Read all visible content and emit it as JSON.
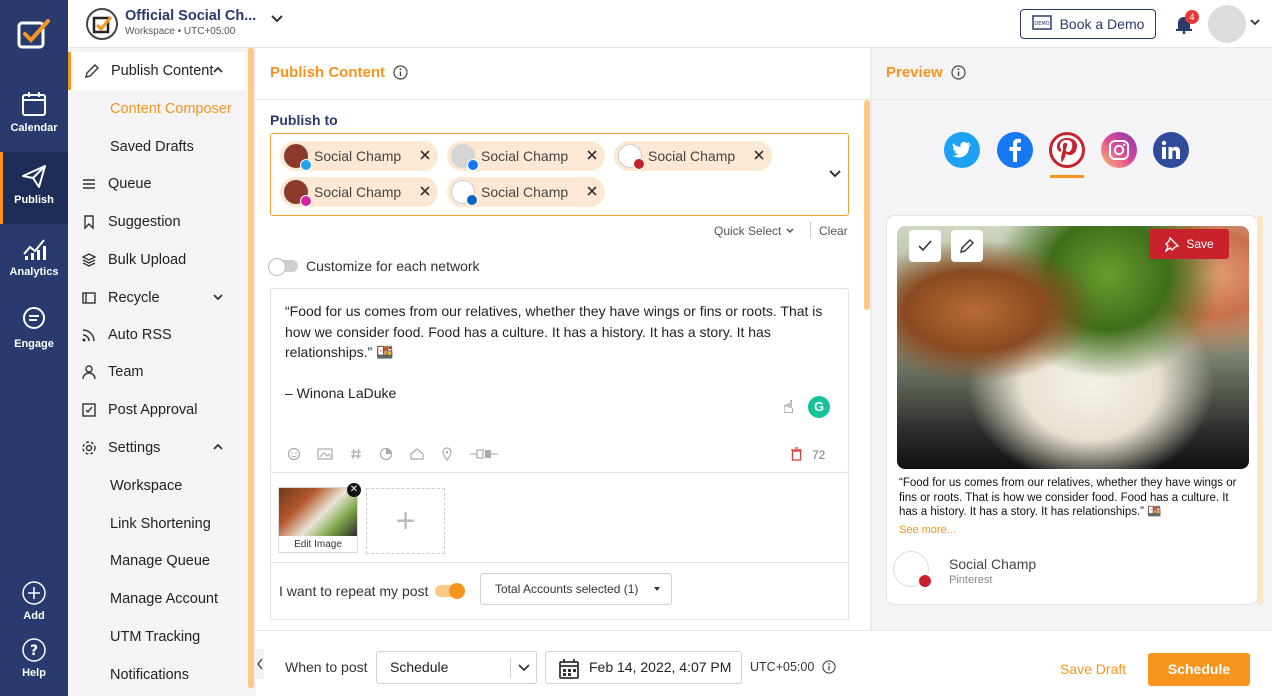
{
  "workspace": {
    "name": "Official Social Ch...",
    "subtitle": "Workspace • UTC+05:00"
  },
  "header": {
    "demo_label": "Book a Demo",
    "notification_count": "4"
  },
  "rail": [
    {
      "label": "Calendar"
    },
    {
      "label": "Publish"
    },
    {
      "label": "Analytics"
    },
    {
      "label": "Engage"
    },
    {
      "label": "Add"
    },
    {
      "label": "Help"
    }
  ],
  "submenu": {
    "publish_content": "Publish Content",
    "content_composer": "Content Composer",
    "saved_drafts": "Saved Drafts",
    "queue": "Queue",
    "suggestion": "Suggestion",
    "bulk_upload": "Bulk Upload",
    "recycle": "Recycle",
    "auto_rss": "Auto RSS",
    "team": "Team",
    "post_approval": "Post Approval",
    "settings": "Settings",
    "workspace": "Workspace",
    "link_shortening": "Link Shortening",
    "manage_queue": "Manage Queue",
    "manage_account": "Manage Account",
    "utm_tracking": "UTM Tracking",
    "notifications": "Notifications"
  },
  "composer": {
    "title": "Publish Content",
    "publish_to": "Publish to",
    "accounts": [
      {
        "name": "Social Champ",
        "network": "twitter",
        "color": "#1da1f2"
      },
      {
        "name": "Social Champ",
        "network": "facebook",
        "color": "#1877f2"
      },
      {
        "name": "Social Champ",
        "network": "pinterest",
        "color": "#c8232c"
      },
      {
        "name": "Social Champ",
        "network": "instagram",
        "color": "#d6249f"
      },
      {
        "name": "Social Champ",
        "network": "linkedin",
        "color": "#0a66c2"
      }
    ],
    "quick_select": "Quick Select",
    "clear": "Clear",
    "customize": "Customize for each network",
    "text_line1": "“Food for us comes from our relatives, whether they have wings or fins or roots. That is how we consider food. Food has a culture. It has a history. It has a story. It has relationships.” 🍱",
    "text_line2": "– Winona LaDuke",
    "char_count": "72",
    "edit_image": "Edit Image",
    "repeat_label": "I want to repeat my post",
    "total_accounts": "Total Accounts selected (1)"
  },
  "preview": {
    "title": "Preview",
    "save": "Save",
    "text": "“Food for us comes from our relatives, whether they have wings or fins or roots. That is how we consider food. Food has a culture. It has a history. It has a story. It has relationships.” 🍱",
    "see_more": "See more...",
    "account_name": "Social Champ",
    "account_network": "Pinterest"
  },
  "bottom": {
    "when_to_post": "When to post",
    "schedule_option": "Schedule",
    "datetime": "Feb 14, 2022, 4:07 PM",
    "timezone": "UTC+05:00",
    "save_draft": "Save Draft",
    "schedule_button": "Schedule"
  },
  "colors": {
    "accent": "#f7941d",
    "navy": "#283a6e"
  }
}
